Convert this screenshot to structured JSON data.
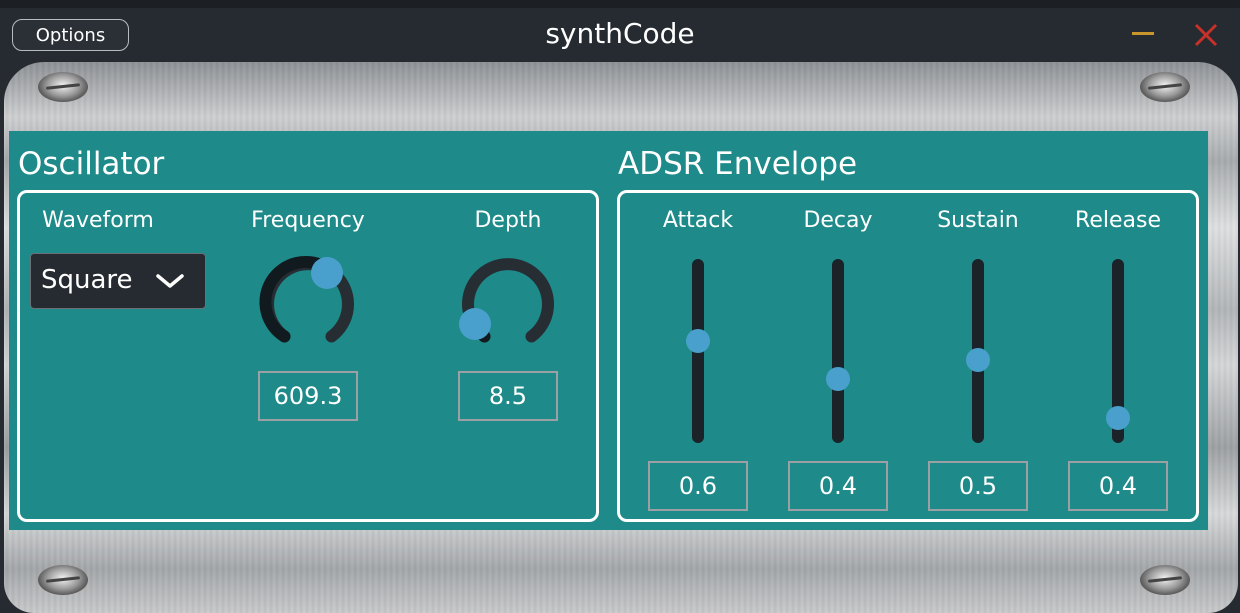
{
  "window": {
    "title": "synthCode",
    "options_label": "Options"
  },
  "oscillator": {
    "title": "Oscillator",
    "waveform": {
      "label": "Waveform",
      "selected": "Square"
    },
    "frequency": {
      "label": "Frequency",
      "value": "609.3"
    },
    "depth": {
      "label": "Depth",
      "value": "8.5"
    }
  },
  "adsr": {
    "title": "ADSR Envelope",
    "attack": {
      "label": "Attack",
      "value": "0.6"
    },
    "decay": {
      "label": "Decay",
      "value": "0.4"
    },
    "sustain": {
      "label": "Sustain",
      "value": "0.5"
    },
    "release": {
      "label": "Release",
      "value": "0.4"
    }
  },
  "colors": {
    "panel": "#1e8a8a",
    "accent": "#4aa0cc",
    "titlebar": "#262b31",
    "minimize": "#c8962a",
    "close": "#c8302a"
  },
  "icons": {
    "close": "close-icon",
    "minimize": "minimize-icon",
    "dropdown": "chevron-down-icon"
  }
}
